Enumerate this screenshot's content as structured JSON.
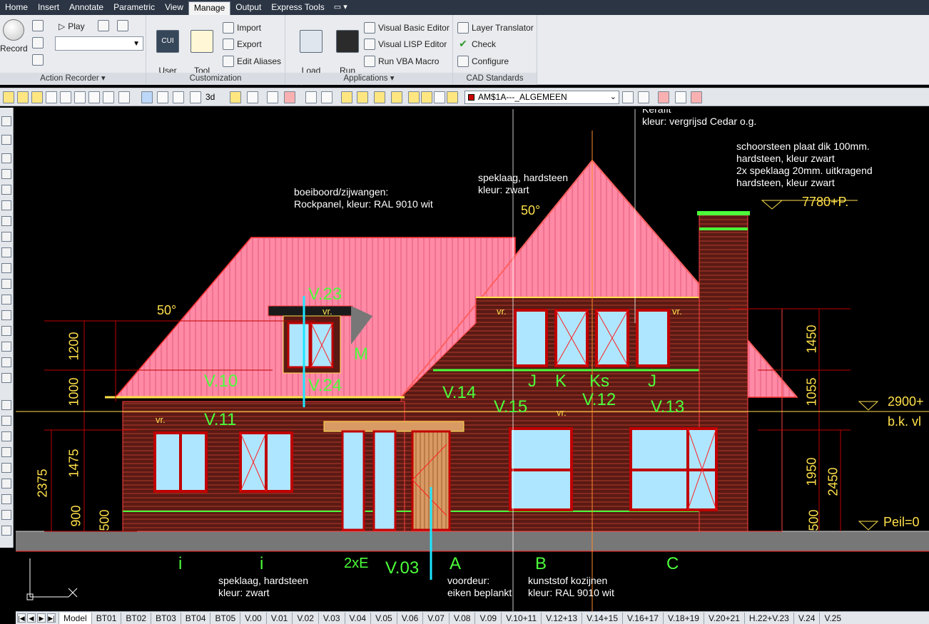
{
  "ribbon": {
    "tabs": [
      "Home",
      "Insert",
      "Annotate",
      "Parametric",
      "View",
      "Manage",
      "Output",
      "Express Tools"
    ],
    "active_tab": "Manage",
    "extra": "▭ ▾",
    "panels": {
      "action_recorder": {
        "title": "Action Recorder ▾",
        "record": "Record",
        "play": "Play"
      },
      "customization": {
        "title": "Customization",
        "user_interface": "User\nInterface",
        "tool_palettes": "Tool\nPalettes",
        "import": "Import",
        "export": "Export",
        "edit_aliases": "Edit Aliases",
        "cui_badge": "CUI"
      },
      "applications": {
        "title": "Applications ▾",
        "load_application": "Load\nApplication",
        "run_script": "Run\nScript",
        "vbe": "Visual Basic Editor",
        "vlisp": "Visual LISP Editor",
        "vba": "Run VBA Macro"
      },
      "cad_standards": {
        "title": "CAD Standards",
        "layer_translator": "Layer Translator",
        "check": "Check",
        "configure": "Configure"
      }
    }
  },
  "toolbar": {
    "layer_name": "AM$1A---_ALGEMEEN",
    "view_3d": "3d"
  },
  "drawing": {
    "notes": {
      "kerafit": "Kerafit\nkleur: vergrijsd Cedar o.g.",
      "schoorsteen": "schoorsteen plaat dik 100mm.\nhardsteen, kleur zwart\n2x speklaag 20mm. uitkragend\nhardsteen, kleur zwart",
      "speklaag_top": "speklaag, hardsteen\nkleur: zwart",
      "boeiboord": "boeiboord/zijwangen:\nRockpanel, kleur: RAL 9010 wit",
      "speklaag_bottom": "speklaag, hardsteen\nkleur: zwart",
      "voordeur": "voordeur:\neiken beplankt",
      "kozijnen": "kunststof kozijnen\nkleur: RAL 9010 wit",
      "level_top": "7780+P.",
      "level_mid": "2900+",
      "bk_vl": "b.k. vl",
      "peil": "Peil=0"
    },
    "angles": {
      "left": "50°",
      "right": "50°"
    },
    "green_labels": [
      "V.23",
      "V.24",
      "V.10",
      "V.11",
      "V.14",
      "V.15",
      "V.12",
      "V.13",
      "V.03",
      "M",
      "J",
      "K",
      "Ks",
      "J",
      "A",
      "B",
      "C",
      "i",
      "i",
      "2xE"
    ],
    "vr": "vr.",
    "dims_left": [
      "1200",
      "1000",
      "1475",
      "900",
      "2375",
      "500"
    ],
    "dims_right": [
      "1450",
      "1055",
      "1950",
      "2450",
      "500"
    ]
  },
  "layouts": {
    "tabs": [
      "Model",
      "BT01",
      "BT02",
      "BT03",
      "BT04",
      "BT05",
      "V.00",
      "V.01",
      "V.02",
      "V.03",
      "V.04",
      "V.05",
      "V.06",
      "V.07",
      "V.08",
      "V.09",
      "V.10+11",
      "V.12+13",
      "V.14+15",
      "V.16+17",
      "V.18+19",
      "V.20+21",
      "H.22+V.23",
      "V.24",
      "V.25"
    ],
    "active": "Model"
  },
  "colors": {
    "roof": "#ff8aa5",
    "brick": "#5a1a14",
    "window_glass": "#aee6ff",
    "annotation_green": "#4cff3a",
    "dimension_yellow": "#ffe04a"
  }
}
